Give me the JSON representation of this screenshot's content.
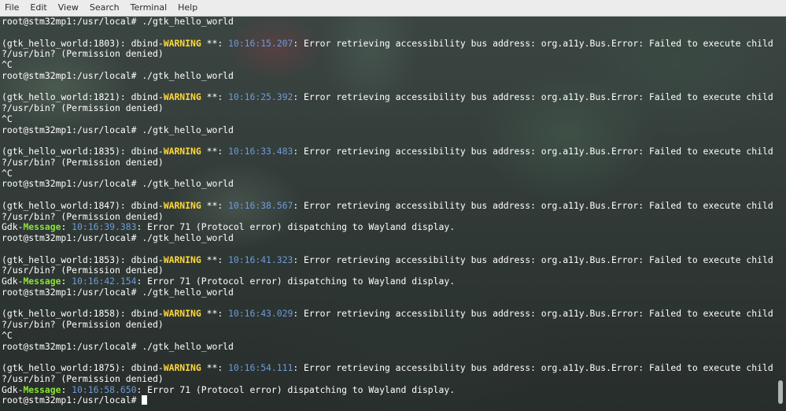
{
  "menubar": {
    "items": [
      "File",
      "Edit",
      "View",
      "Search",
      "Terminal",
      "Help"
    ]
  },
  "terminal": {
    "prompt": "root@stm32mp1:/usr/local# ",
    "lines": [
      {
        "type": "cmd",
        "text": "./gtk_hello_world"
      },
      {
        "type": "blank"
      },
      {
        "type": "warn",
        "pre": "(gtk_hello_world:1803): dbind-",
        "label": "WARNING",
        "mid": " **: ",
        "ts": "10:16:15.207",
        "msg": ": Error retrieving accessibility bus address: org.a11y.Bus.Error: Failed to execute child process"
      },
      {
        "type": "text",
        "text": "?/usr/bin? (Permission denied)"
      },
      {
        "type": "text",
        "text": "^C"
      },
      {
        "type": "cmd",
        "text": "./gtk_hello_world"
      },
      {
        "type": "blank"
      },
      {
        "type": "warn",
        "pre": "(gtk_hello_world:1821): dbind-",
        "label": "WARNING",
        "mid": " **: ",
        "ts": "10:16:25.392",
        "msg": ": Error retrieving accessibility bus address: org.a11y.Bus.Error: Failed to execute child process"
      },
      {
        "type": "text",
        "text": "?/usr/bin? (Permission denied)"
      },
      {
        "type": "text",
        "text": "^C"
      },
      {
        "type": "cmd",
        "text": "./gtk_hello_world"
      },
      {
        "type": "blank"
      },
      {
        "type": "warn",
        "pre": "(gtk_hello_world:1835): dbind-",
        "label": "WARNING",
        "mid": " **: ",
        "ts": "10:16:33.483",
        "msg": ": Error retrieving accessibility bus address: org.a11y.Bus.Error: Failed to execute child process"
      },
      {
        "type": "text",
        "text": "?/usr/bin? (Permission denied)"
      },
      {
        "type": "text",
        "text": "^C"
      },
      {
        "type": "cmd",
        "text": "./gtk_hello_world"
      },
      {
        "type": "blank"
      },
      {
        "type": "warn",
        "pre": "(gtk_hello_world:1847): dbind-",
        "label": "WARNING",
        "mid": " **: ",
        "ts": "10:16:38.567",
        "msg": ": Error retrieving accessibility bus address: org.a11y.Bus.Error: Failed to execute child process"
      },
      {
        "type": "text",
        "text": "?/usr/bin? (Permission denied)"
      },
      {
        "type": "gdk",
        "pre": "Gdk-",
        "label": "Message",
        "mid": ": ",
        "ts": "10:16:39.383",
        "msg": ": Error 71 (Protocol error) dispatching to Wayland display."
      },
      {
        "type": "cmd",
        "text": "./gtk_hello_world"
      },
      {
        "type": "blank"
      },
      {
        "type": "warn",
        "pre": "(gtk_hello_world:1853): dbind-",
        "label": "WARNING",
        "mid": " **: ",
        "ts": "10:16:41.323",
        "msg": ": Error retrieving accessibility bus address: org.a11y.Bus.Error: Failed to execute child process"
      },
      {
        "type": "text",
        "text": "?/usr/bin? (Permission denied)"
      },
      {
        "type": "gdk",
        "pre": "Gdk-",
        "label": "Message",
        "mid": ": ",
        "ts": "10:16:42.154",
        "msg": ": Error 71 (Protocol error) dispatching to Wayland display."
      },
      {
        "type": "cmd",
        "text": "./gtk_hello_world"
      },
      {
        "type": "blank"
      },
      {
        "type": "warn",
        "pre": "(gtk_hello_world:1858): dbind-",
        "label": "WARNING",
        "mid": " **: ",
        "ts": "10:16:43.029",
        "msg": ": Error retrieving accessibility bus address: org.a11y.Bus.Error: Failed to execute child process"
      },
      {
        "type": "text",
        "text": "?/usr/bin? (Permission denied)"
      },
      {
        "type": "text",
        "text": "^C"
      },
      {
        "type": "cmd",
        "text": "./gtk_hello_world"
      },
      {
        "type": "blank"
      },
      {
        "type": "warn",
        "pre": "(gtk_hello_world:1875): dbind-",
        "label": "WARNING",
        "mid": " **: ",
        "ts": "10:16:54.111",
        "msg": ": Error retrieving accessibility bus address: org.a11y.Bus.Error: Failed to execute child process"
      },
      {
        "type": "text",
        "text": "?/usr/bin? (Permission denied)"
      },
      {
        "type": "gdk",
        "pre": "Gdk-",
        "label": "Message",
        "mid": ": ",
        "ts": "10:16:58.650",
        "msg": ": Error 71 (Protocol error) dispatching to Wayland display."
      },
      {
        "type": "cmd",
        "text": "",
        "cursor": true
      }
    ]
  },
  "colors": {
    "warning": "#ffd83a",
    "timestamp": "#6f9ad8",
    "message": "#8be234",
    "text": "#ffffff"
  }
}
